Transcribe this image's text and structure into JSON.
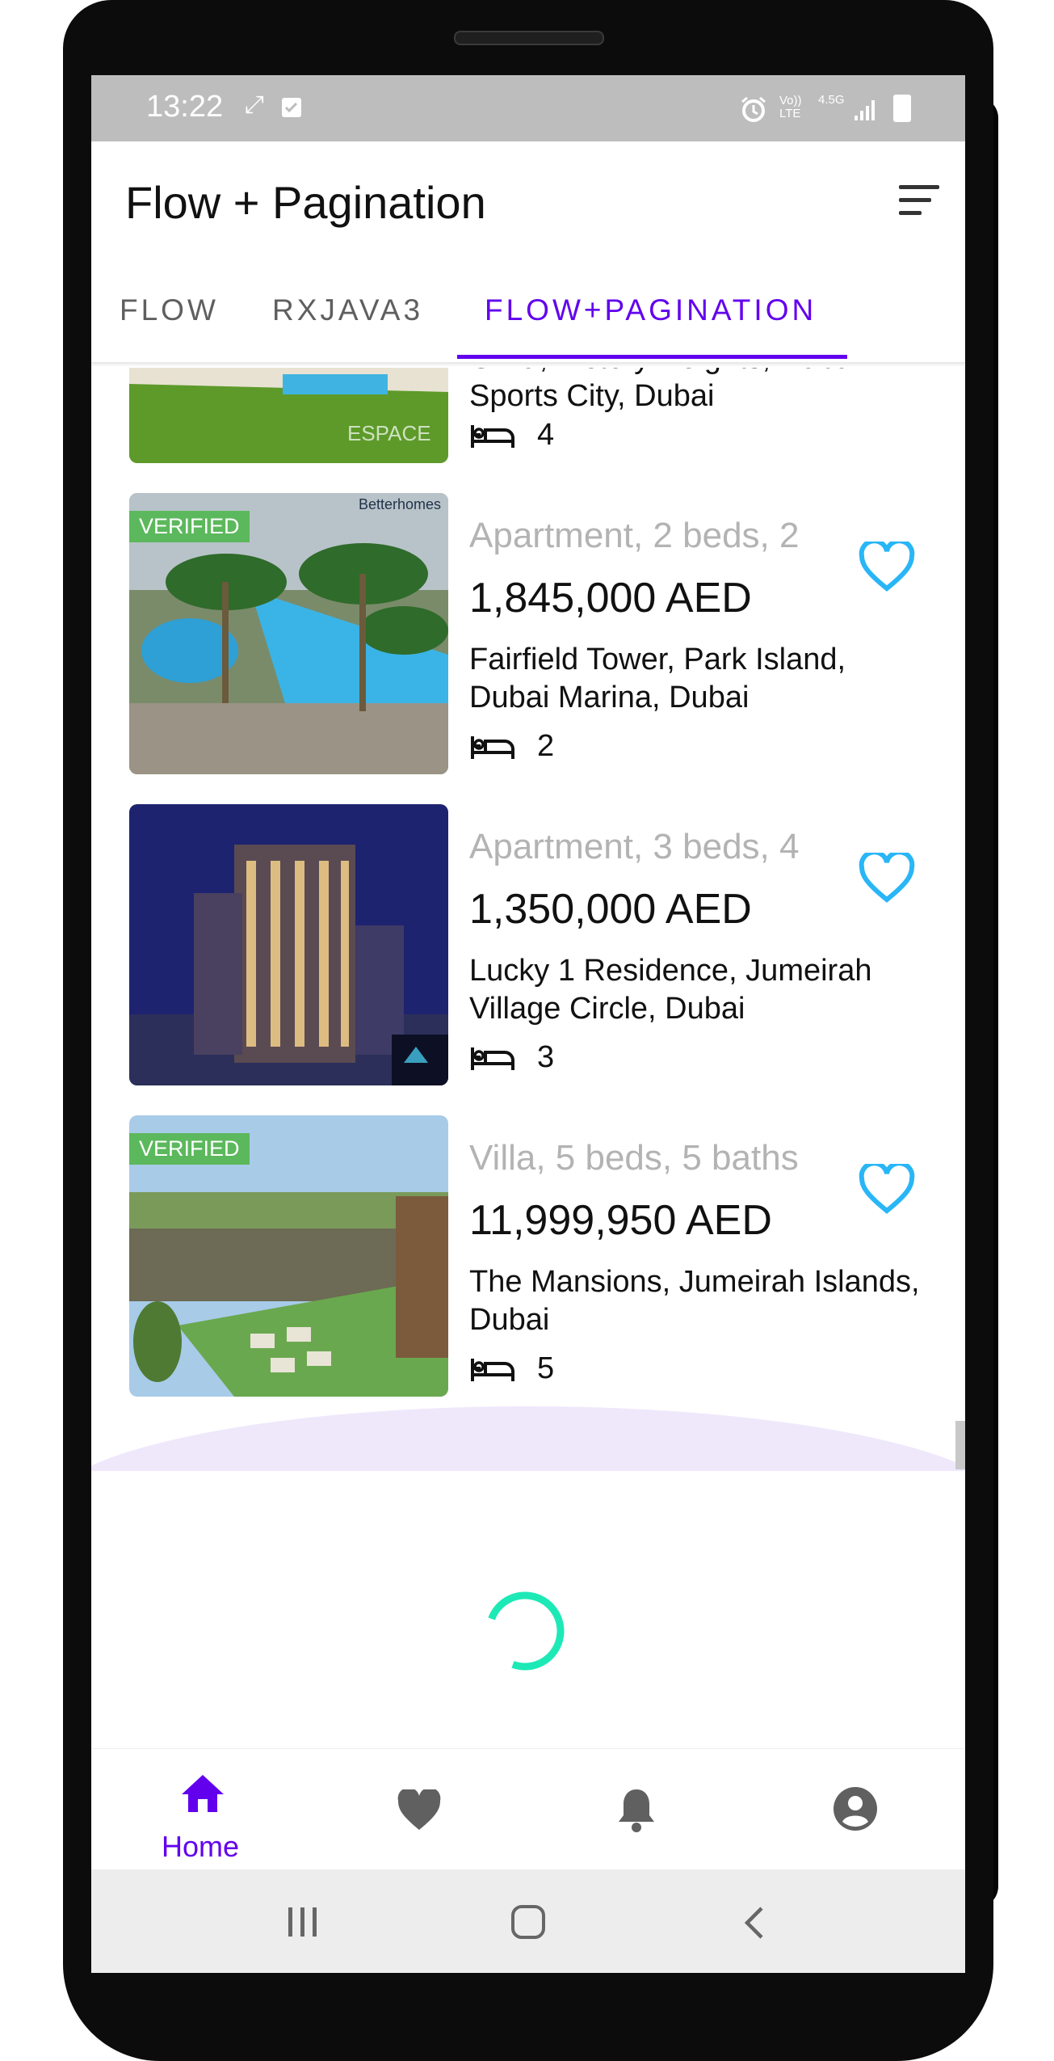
{
  "status_bar": {
    "time": "13:22",
    "left_icons": [
      "sync-icon",
      "checkbox-icon"
    ],
    "right_icons": [
      "alarm-icon",
      "volte-icon",
      "4-5g-icon",
      "signal-icon",
      "battery-icon"
    ],
    "volte_label": "Vo)) LTE",
    "network_label": "4.5G"
  },
  "app_bar": {
    "title": "Flow + Pagination",
    "sort_icon": "sort-icon"
  },
  "tabs": [
    {
      "label": "FLOW",
      "active": false
    },
    {
      "label": "RXJAVA3",
      "active": false
    },
    {
      "label": "FLOW+PAGINATION",
      "active": true
    }
  ],
  "listings": [
    {
      "subtitle": "",
      "price": "",
      "address": "Oliva, Victory Heights, Dubai Sports City, Dubai",
      "beds": "4",
      "verified": false,
      "image_watermark": "ESPACE"
    },
    {
      "subtitle": "Apartment, 2 beds, 2",
      "price": "1,845,000 AED",
      "address": "Fairfield Tower, Park Island, Dubai Marina, Dubai",
      "beds": "2",
      "verified": true,
      "verified_label": "VERIFIED",
      "image_watermark": "Betterhomes"
    },
    {
      "subtitle": "Apartment, 3 beds, 4",
      "price": "1,350,000 AED",
      "address": "Lucky 1 Residence, Jumeirah Village Circle, Dubai",
      "beds": "3",
      "verified": false,
      "image_watermark": ""
    },
    {
      "subtitle": "Villa, 5 beds, 5 baths",
      "price": "11,999,950 AED",
      "address": "The Mansions, Jumeirah Islands, Dubai",
      "beds": "5",
      "verified": true,
      "verified_label": "VERIFIED",
      "image_watermark": ""
    }
  ],
  "bottom_nav": [
    {
      "label": "Home",
      "icon": "home-icon",
      "active": true
    },
    {
      "label": "",
      "icon": "heart-icon",
      "active": false
    },
    {
      "label": "",
      "icon": "bell-icon",
      "active": false
    },
    {
      "label": "",
      "icon": "account-icon",
      "active": false
    }
  ],
  "system_nav": [
    "recents-icon",
    "home-circle-icon",
    "back-icon"
  ],
  "colors": {
    "accent": "#6200ee",
    "heart": "#29b6f6",
    "verified": "#5cb85c",
    "spinner": "#1de9b6",
    "status_bar": "#bdbdbd"
  }
}
